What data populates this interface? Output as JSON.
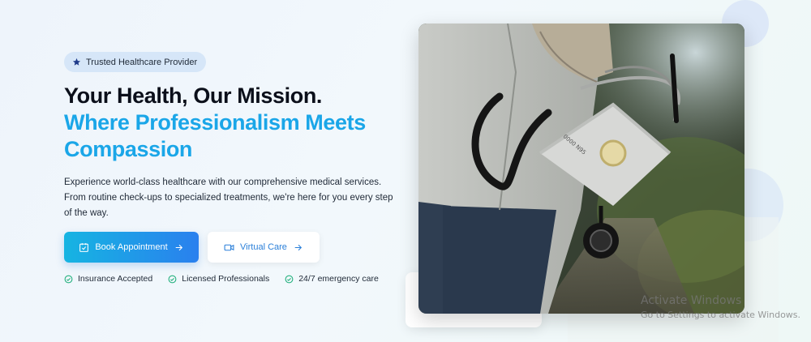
{
  "hero": {
    "badge": {
      "label": "Trusted Healthcare Provider",
      "icon": "star-icon"
    },
    "title_line1": "Your Health, Our Mission.",
    "title_line2a": "Where Professionalism Meets",
    "title_line2b": "Compassion",
    "description": "Experience world-class healthcare with our comprehensive medical services. From routine check-ups to specialized treatments, we're here for you every step of the way.",
    "primary_button": {
      "label": "Book Appointment",
      "icon": "calendar-check-icon",
      "arrow": "arrow-right-icon"
    },
    "secondary_button": {
      "label": "Virtual Care",
      "icon": "video-icon",
      "arrow": "arrow-right-icon"
    },
    "features": [
      {
        "label": "Insurance Accepted",
        "icon": "check-circle-icon"
      },
      {
        "label": "Licensed Professionals",
        "icon": "check-circle-icon"
      },
      {
        "label": "24/7 emergency care",
        "icon": "check-circle-icon"
      }
    ]
  },
  "windows_watermark": {
    "title": "Activate Windows",
    "subtitle": "Go to Settings to activate Windows."
  },
  "colors": {
    "accent_blue": "#1aa6e8",
    "button_gradient_start": "#16b4e2",
    "button_gradient_end": "#2a80ee",
    "check_green": "#22b07d",
    "badge_bg": "#d6e6f8"
  }
}
